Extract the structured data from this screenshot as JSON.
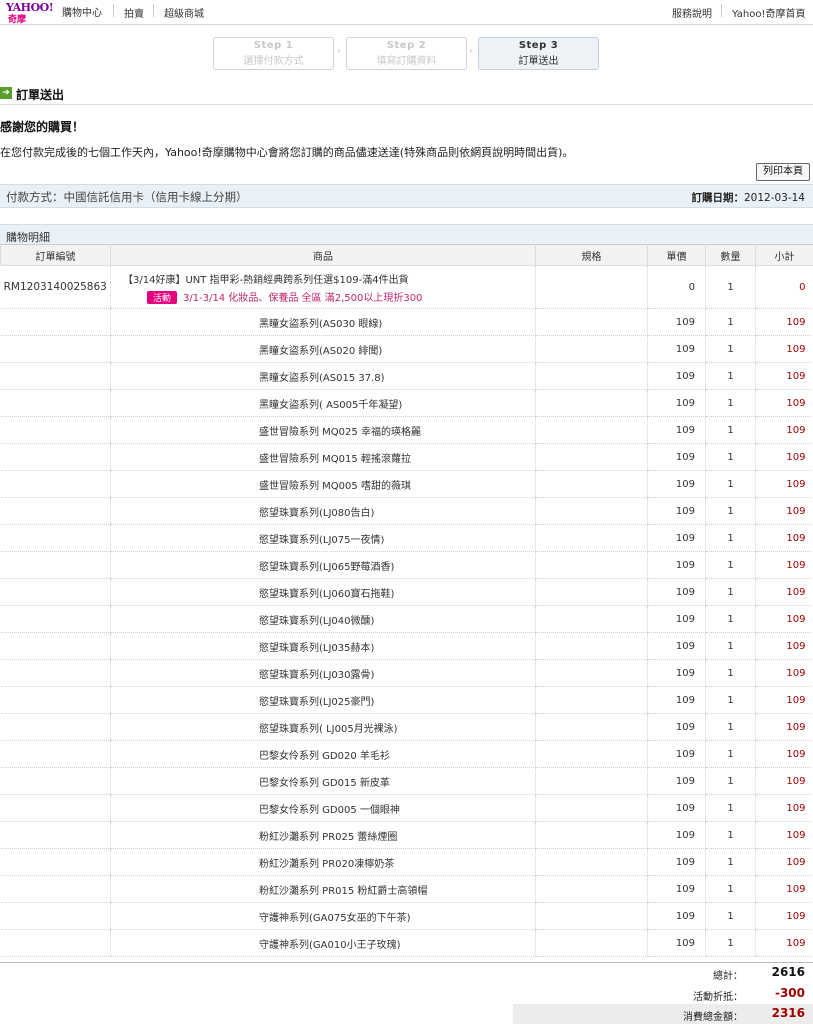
{
  "header": {
    "logo_text": "YAHOO!",
    "logo_sub": "奇摩",
    "shop_center": "購物中心",
    "nav_left": [
      "拍賣",
      "超級商城"
    ],
    "nav_right": [
      "服務說明",
      "Yahoo!奇摩首頁"
    ]
  },
  "steps": [
    {
      "title": "Step 1",
      "label": "選擇付款方式"
    },
    {
      "title": "Step 2",
      "label": "填寫訂購資料"
    },
    {
      "title": "Step 3",
      "label": "訂單送出"
    }
  ],
  "section_title": "訂單送出",
  "thanks": "感謝您的購買！",
  "message": "在您付款完成後的七個工作天內，Yahoo!奇摩購物中心會將您訂購的商品儘速送達(特殊商品則依網頁說明時間出貨)。",
  "print_button": "列印本頁",
  "payment": {
    "method": "付款方式：中國信託信用卡（信用卡線上分期）",
    "date_label": "訂購日期：",
    "date": "2012-03-14"
  },
  "detail_title": "購物明細",
  "table": {
    "headers": [
      "訂單編號",
      "商品",
      "規格",
      "單價",
      "數量",
      "小計"
    ],
    "order_no": "RM1203140025863",
    "main_item": {
      "name": "【3/14好康】UNT 指甲彩-熱銷經典跨系列任選$109-滿4件出貨",
      "promo_tag": "活動",
      "promo_text": "3/1-3/14 化妝品、保養品 全區 滿2,500以上現折300",
      "price": "0",
      "qty": "1",
      "subtotal": "0"
    },
    "rows": [
      {
        "name": "黑瞳女盜系列(AS030 眼線)",
        "price": "109",
        "qty": "1",
        "subtotal": "109"
      },
      {
        "name": "黑瞳女盜系列(AS020 緋聞)",
        "price": "109",
        "qty": "1",
        "subtotal": "109"
      },
      {
        "name": "黑瞳女盜系列(AS015 37.8)",
        "price": "109",
        "qty": "1",
        "subtotal": "109"
      },
      {
        "name": "黑瞳女盜系列( AS005千年凝望)",
        "price": "109",
        "qty": "1",
        "subtotal": "109"
      },
      {
        "name": "盛世冒險系列 MQ025 幸福的瑛格麗",
        "price": "109",
        "qty": "1",
        "subtotal": "109"
      },
      {
        "name": "盛世冒險系列 MQ015 輕搖滾蘿拉",
        "price": "109",
        "qty": "1",
        "subtotal": "109"
      },
      {
        "name": "盛世冒險系列 MQ005 嗜甜的薇琪",
        "price": "109",
        "qty": "1",
        "subtotal": "109"
      },
      {
        "name": "慾望珠寶系列(LJ080告白)",
        "price": "109",
        "qty": "1",
        "subtotal": "109"
      },
      {
        "name": "慾望珠寶系列(LJ075一夜情)",
        "price": "109",
        "qty": "1",
        "subtotal": "109"
      },
      {
        "name": "慾望珠寶系列(LJ065野莓酒香)",
        "price": "109",
        "qty": "1",
        "subtotal": "109"
      },
      {
        "name": "慾望珠寶系列(LJ060寶石拖鞋)",
        "price": "109",
        "qty": "1",
        "subtotal": "109"
      },
      {
        "name": "慾望珠寶系列(LJ040微醺)",
        "price": "109",
        "qty": "1",
        "subtotal": "109"
      },
      {
        "name": "慾望珠寶系列(LJ035赫本)",
        "price": "109",
        "qty": "1",
        "subtotal": "109"
      },
      {
        "name": "慾望珠寶系列(LJ030露骨)",
        "price": "109",
        "qty": "1",
        "subtotal": "109"
      },
      {
        "name": "慾望珠寶系列(LJ025豪門)",
        "price": "109",
        "qty": "1",
        "subtotal": "109"
      },
      {
        "name": "慾望珠寶系列( LJ005月光裸泳)",
        "price": "109",
        "qty": "1",
        "subtotal": "109"
      },
      {
        "name": "巴黎女伶系列 GD020 羊毛衫",
        "price": "109",
        "qty": "1",
        "subtotal": "109"
      },
      {
        "name": "巴黎女伶系列 GD015 新皮革",
        "price": "109",
        "qty": "1",
        "subtotal": "109"
      },
      {
        "name": "巴黎女伶系列 GD005 一個眼神",
        "price": "109",
        "qty": "1",
        "subtotal": "109"
      },
      {
        "name": "粉紅沙灘系列 PR025 蕾絲煙圈",
        "price": "109",
        "qty": "1",
        "subtotal": "109"
      },
      {
        "name": "粉紅沙灘系列 PR020凍檸奶茶",
        "price": "109",
        "qty": "1",
        "subtotal": "109"
      },
      {
        "name": "粉紅沙灘系列 PR015 粉紅爵士高領帽",
        "price": "109",
        "qty": "1",
        "subtotal": "109"
      },
      {
        "name": "守護神系列(GA075女巫的下午茶)",
        "price": "109",
        "qty": "1",
        "subtotal": "109"
      },
      {
        "name": "守護神系列(GA010小王子玫瑰)",
        "price": "109",
        "qty": "1",
        "subtotal": "109"
      }
    ]
  },
  "totals": {
    "total_label": "總計：",
    "total": "2616",
    "discount_label": "活動折抵：",
    "discount": "-300",
    "grand_label": "消費總金額：",
    "grand": "2316"
  },
  "colors": {
    "accent_red": "#a00000",
    "header_bg": "#e9f0f6",
    "promo_pink": "#e6007e"
  }
}
